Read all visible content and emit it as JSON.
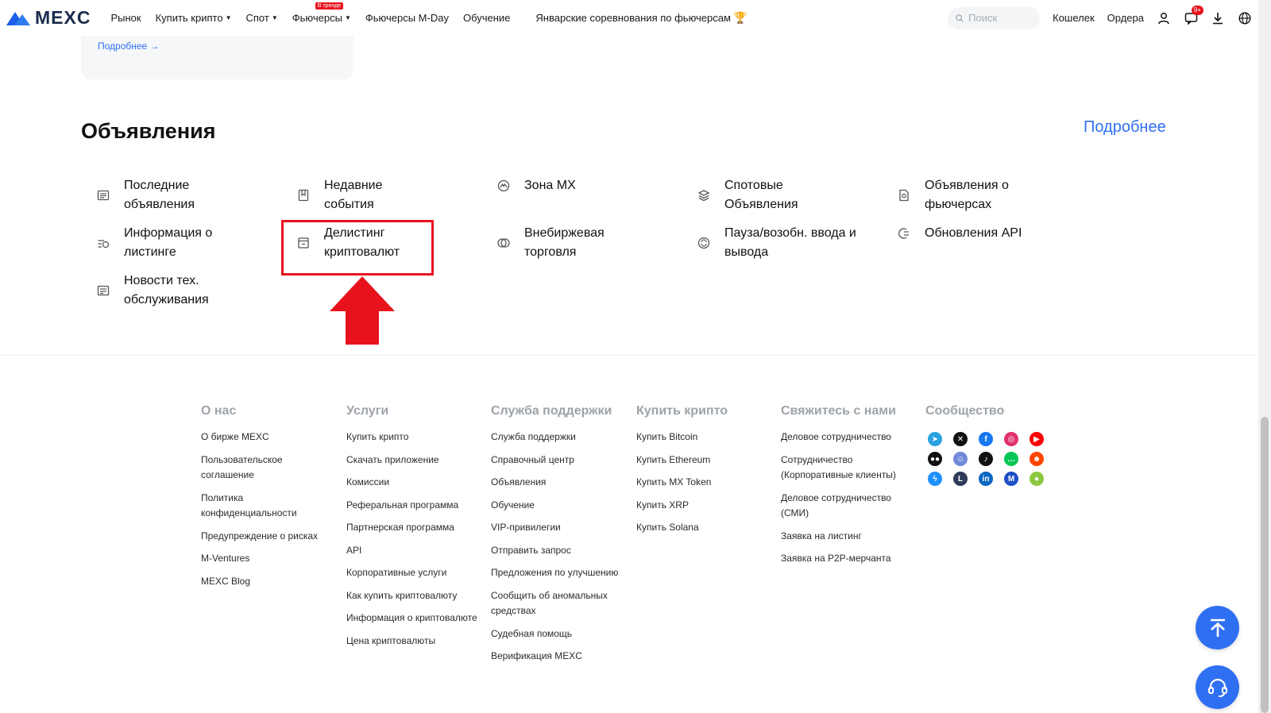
{
  "header": {
    "logo_text": "MEXC",
    "nav": [
      {
        "label": "Рынок",
        "caret": false
      },
      {
        "label": "Купить крипто",
        "caret": true
      },
      {
        "label": "Спот",
        "caret": true
      },
      {
        "label": "Фьючерсы",
        "caret": true,
        "badge": "В тренде"
      },
      {
        "label": "Фьючерсы M-Day",
        "caret": false
      },
      {
        "label": "Обучение",
        "caret": false
      }
    ],
    "promo": "Январские соревнования по фьючерсам",
    "search_placeholder": "Поиск",
    "wallet": "Кошелек",
    "orders": "Ордера",
    "notif_count": "9+"
  },
  "card": {
    "more_label": "Подробнее →"
  },
  "announcements": {
    "title": "Объявления",
    "more_label": "Подробнее",
    "items": [
      {
        "label": "Последние объявления",
        "icon": "news-icon"
      },
      {
        "label": "Недавние события",
        "icon": "bookmark-icon"
      },
      {
        "label": "Зона MX",
        "icon": "mx-zone-icon"
      },
      {
        "label": "Спотовые Объявления",
        "icon": "spot-icon"
      },
      {
        "label": "Объявления о фьючерсах",
        "icon": "futures-doc-icon"
      },
      {
        "label": "Информация о листинге",
        "icon": "listing-icon"
      },
      {
        "label": "Делистинг криптовалют",
        "icon": "delisting-icon"
      },
      {
        "label": "Внебиржевая торговля",
        "icon": "otc-icon"
      },
      {
        "label": "Пауза/возобн. ввода и вывода",
        "icon": "pause-icon"
      },
      {
        "label": "Обновления API",
        "icon": "api-icon"
      },
      {
        "label": "Новости тех. обслуживания",
        "icon": "maintenance-icon"
      }
    ]
  },
  "footer": {
    "columns": [
      {
        "title": "О нас",
        "links": [
          "О бирже MEXC",
          "Пользовательское соглашение",
          "Политика конфиденциальности",
          "Предупреждение о рисках",
          "M-Ventures",
          "MEXC Blog"
        ]
      },
      {
        "title": "Услуги",
        "links": [
          "Купить крипто",
          "Скачать приложение",
          "Комиссии",
          "Реферальная программа",
          "Партнерская программа",
          "API",
          "Корпоративные услуги",
          "Как купить криптовалюту",
          "Информация о криптовалюте",
          "Цена криптовалюты"
        ]
      },
      {
        "title": "Служба поддержки",
        "links": [
          "Служба поддержки",
          "Справочный центр",
          "Объявления",
          "Обучение",
          "VIP-привилегии",
          "Отправить запрос",
          "Предложения по улучшению",
          "Сообщить об аномальных средствах",
          "Судебная помощь",
          "Верификация MEXC"
        ]
      },
      {
        "title": "Купить крипто",
        "links": [
          "Купить Bitcoin",
          "Купить Ethereum",
          "Купить MX Token",
          "Купить XRP",
          "Купить Solana"
        ]
      },
      {
        "title": "Свяжитесь с нами",
        "links": [
          "Деловое сотрудничество",
          "Сотрудничество (Корпоративные клиенты)",
          "Деловое сотрудничество (СМИ)",
          "Заявка на листинг",
          "Заявка на P2P-мерчанта"
        ]
      },
      {
        "title": "Сообщество",
        "links": []
      }
    ],
    "social": [
      {
        "name": "telegram-icon",
        "color": "#2aa3e0",
        "glyph": "➤"
      },
      {
        "name": "x-icon",
        "color": "#111111",
        "glyph": "✕"
      },
      {
        "name": "facebook-icon",
        "color": "#1877f2",
        "glyph": "f"
      },
      {
        "name": "instagram-icon",
        "color": "#e1306c",
        "glyph": "◎"
      },
      {
        "name": "youtube-icon",
        "color": "#ff0000",
        "glyph": "▶"
      },
      {
        "name": "medium-icon",
        "color": "#111111",
        "glyph": "●●"
      },
      {
        "name": "discord-icon",
        "color": "#7289da",
        "glyph": "☺"
      },
      {
        "name": "tiktok-icon",
        "color": "#111111",
        "glyph": "♪"
      },
      {
        "name": "line-icon",
        "color": "#06c755",
        "glyph": "…"
      },
      {
        "name": "reddit-icon",
        "color": "#ff4500",
        "glyph": "☻"
      },
      {
        "name": "messenger-icon",
        "color": "#1e90ff",
        "glyph": "ϟ"
      },
      {
        "name": "linktree-icon",
        "color": "#2e3a59",
        "glyph": "L"
      },
      {
        "name": "linkedin-icon",
        "color": "#0a66c2",
        "glyph": "in"
      },
      {
        "name": "coinmarketcap-icon",
        "color": "#1e4fc8",
        "glyph": "M"
      },
      {
        "name": "coingecko-icon",
        "color": "#8dc63f",
        "glyph": "●"
      }
    ]
  },
  "colors": {
    "accent": "#2f6ff2",
    "highlight": "#e8121d",
    "muted": "#9ea3aa"
  }
}
